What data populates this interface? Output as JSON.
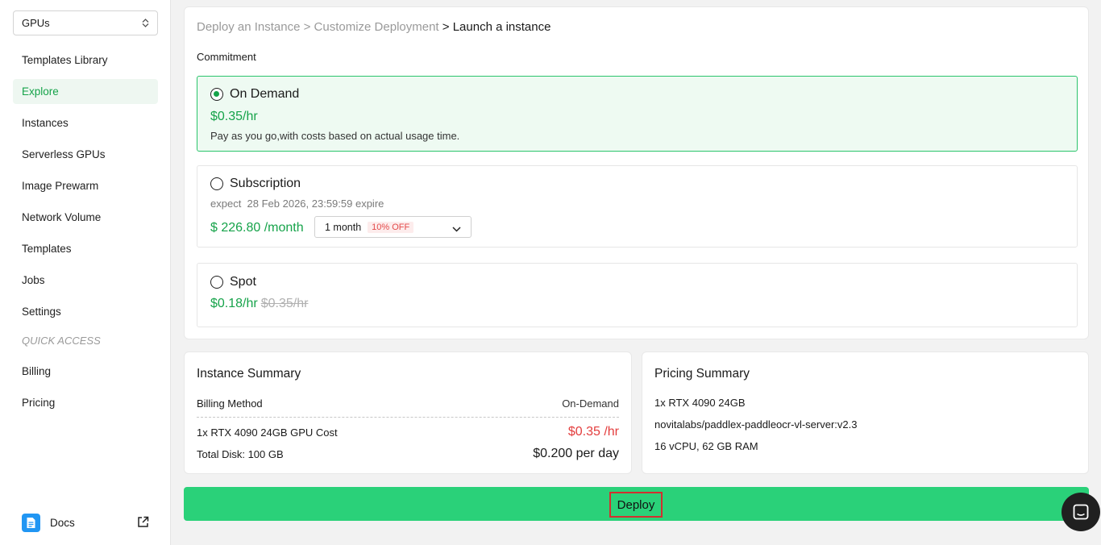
{
  "sidebar": {
    "gpu_select": "GPUs",
    "items": [
      {
        "label": "Templates Library"
      },
      {
        "label": "Explore"
      },
      {
        "label": "Instances"
      },
      {
        "label": "Serverless GPUs"
      },
      {
        "label": "Image Prewarm"
      },
      {
        "label": "Network Volume"
      },
      {
        "label": "Templates"
      },
      {
        "label": "Jobs"
      },
      {
        "label": "Settings"
      }
    ],
    "active_item": "Explore",
    "quick_access_label": "QUICK ACCESS",
    "quick_items": [
      {
        "label": "Billing"
      },
      {
        "label": "Pricing"
      }
    ],
    "docs_label": "Docs"
  },
  "breadcrumb": {
    "step1": "Deploy an Instance",
    "sep": ">",
    "step2": "Customize Deployment",
    "current": "Launch a instance"
  },
  "commitment": {
    "label": "Commitment",
    "on_demand": {
      "title": "On Demand",
      "price": "$0.35/hr",
      "description": "Pay as you go,with costs based on actual usage time.",
      "selected": true
    },
    "subscription": {
      "title": "Subscription",
      "expect": "expect  28 Feb 2026, 23:59:59 expire",
      "price": "$ 226.80 /month",
      "period": "1 month",
      "discount": "10% OFF",
      "selected": false
    },
    "spot": {
      "title": "Spot",
      "price": "$0.18/hr",
      "original_price": "$0.35/hr",
      "selected": false
    }
  },
  "instance_summary": {
    "title": "Instance Summary",
    "billing_method_label": "Billing Method",
    "billing_method_value": "On-Demand",
    "gpu_cost_label": "1x RTX 4090 24GB GPU Cost",
    "gpu_cost_value": "$0.35 /hr",
    "disk_label": "Total Disk: 100 GB",
    "disk_value": "$0.200 per day"
  },
  "pricing_summary": {
    "title": "Pricing Summary",
    "gpu": "1x RTX 4090 24GB",
    "image": "novitalabs/paddlex-paddleocr-vl-server:v2.3",
    "resources": "16 vCPU, 62 GB RAM"
  },
  "deploy_label": "Deploy",
  "colors": {
    "accent_green": "#16a34a",
    "deploy_bar": "#2ad179",
    "price_red": "#e33d3d",
    "highlight_border": "#d32f2f"
  }
}
